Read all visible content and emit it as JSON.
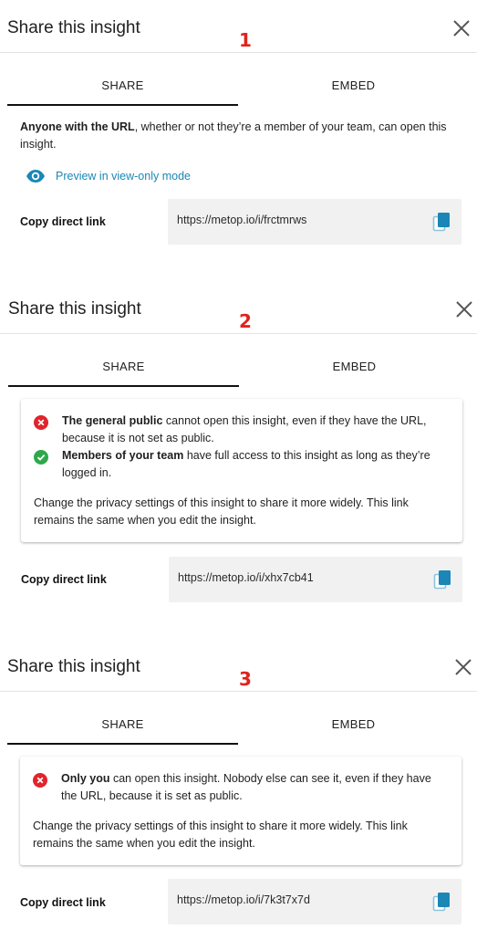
{
  "panels": [
    {
      "title": "Share this insight",
      "step": "1",
      "tabs": [
        "SHARE",
        "EMBED"
      ],
      "description_bold": "Anyone with the URL",
      "description_rest": ", whether or not they’re a member of your team, can open this insight.",
      "preview_label": "Preview in view-only mode",
      "copy_label": "Copy direct link",
      "url": "https://metop.io/i/frctmrws"
    },
    {
      "title": "Share this insight",
      "step": "2",
      "tabs": [
        "SHARE",
        "EMBED"
      ],
      "rows": [
        {
          "bold": "The general public",
          "rest": " cannot open this insight, even if they have the URL, because it is not set as public.",
          "status": "denied"
        },
        {
          "bold": "Members of your team",
          "rest": " have full access to this insight as long as they’re logged in.",
          "status": "allowed"
        }
      ],
      "note": "Change the privacy settings of this insight to share it more widely. This link remains the same when you edit the insight.",
      "copy_label": "Copy direct link",
      "url": "https://metop.io/i/xhx7cb41"
    },
    {
      "title": "Share this insight",
      "step": "3",
      "tabs": [
        "SHARE",
        "EMBED"
      ],
      "rows": [
        {
          "bold": "Only you",
          "rest": " can open this insight. Nobody else can see it, even if they have the URL, because it is set as public.",
          "status": "denied"
        }
      ],
      "note": "Change the privacy settings of this insight to share it more widely. This link remains the same when you edit the insight.",
      "copy_label": "Copy direct link",
      "url": "https://metop.io/i/7k3t7x7d"
    }
  ],
  "colors": {
    "step_number": "#e0231d",
    "link": "#1a87b6",
    "denied": "#e0242c",
    "allowed": "#2ea84a",
    "copy_icon": "#1a87b6"
  },
  "icons": {
    "close": "close-icon",
    "preview": "eye-icon",
    "denied": "x-circle-icon",
    "allowed": "check-circle-icon",
    "copy": "copy-icon"
  }
}
